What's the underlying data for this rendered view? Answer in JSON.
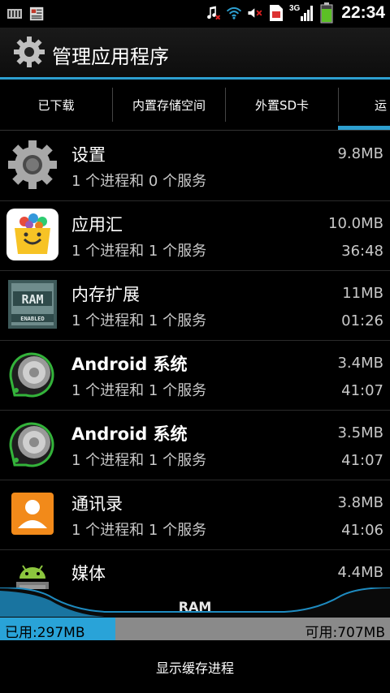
{
  "status_bar": {
    "time": "22:34",
    "network": "3G",
    "icons": [
      "storage-icon",
      "notification-icon",
      "music-muted-icon",
      "wifi-icon",
      "volume-muted-icon",
      "sim-icon",
      "signal-icon",
      "battery-icon"
    ]
  },
  "header": {
    "title": "管理应用程序"
  },
  "tabs": [
    {
      "label": "已下载"
    },
    {
      "label": "内置存储空间"
    },
    {
      "label": "外置SD卡"
    },
    {
      "label": "运"
    }
  ],
  "apps": [
    {
      "name": "设置",
      "sub": "1 个进程和 0 个服务",
      "size": "9.8MB",
      "time": ""
    },
    {
      "name": "应用汇",
      "sub": "1 个进程和 1 个服务",
      "size": "10.0MB",
      "time": "36:48"
    },
    {
      "name": "内存扩展",
      "sub": "1 个进程和 1 个服务",
      "size": "11MB",
      "time": "01:26"
    },
    {
      "name": "Android 系统",
      "sub": "1 个进程和 1 个服务",
      "size": "3.4MB",
      "time": "41:07"
    },
    {
      "name": "Android 系统",
      "sub": "1 个进程和 1 个服务",
      "size": "3.5MB",
      "time": "41:07"
    },
    {
      "name": "通讯录",
      "sub": "1 个进程和 1 个服务",
      "size": "3.8MB",
      "time": "41:06"
    },
    {
      "name": "媒体",
      "sub": "",
      "size": "4.4MB",
      "time": ""
    }
  ],
  "ram": {
    "label": "RAM",
    "used": "已用:297MB",
    "free": "可用:707MB",
    "used_fraction": 0.2958
  },
  "bottom": {
    "button": "显示缓存进程"
  },
  "colors": {
    "accent": "#2d9fd0",
    "ram_used": "#29a3d8",
    "ram_free": "#8a8a8a"
  }
}
